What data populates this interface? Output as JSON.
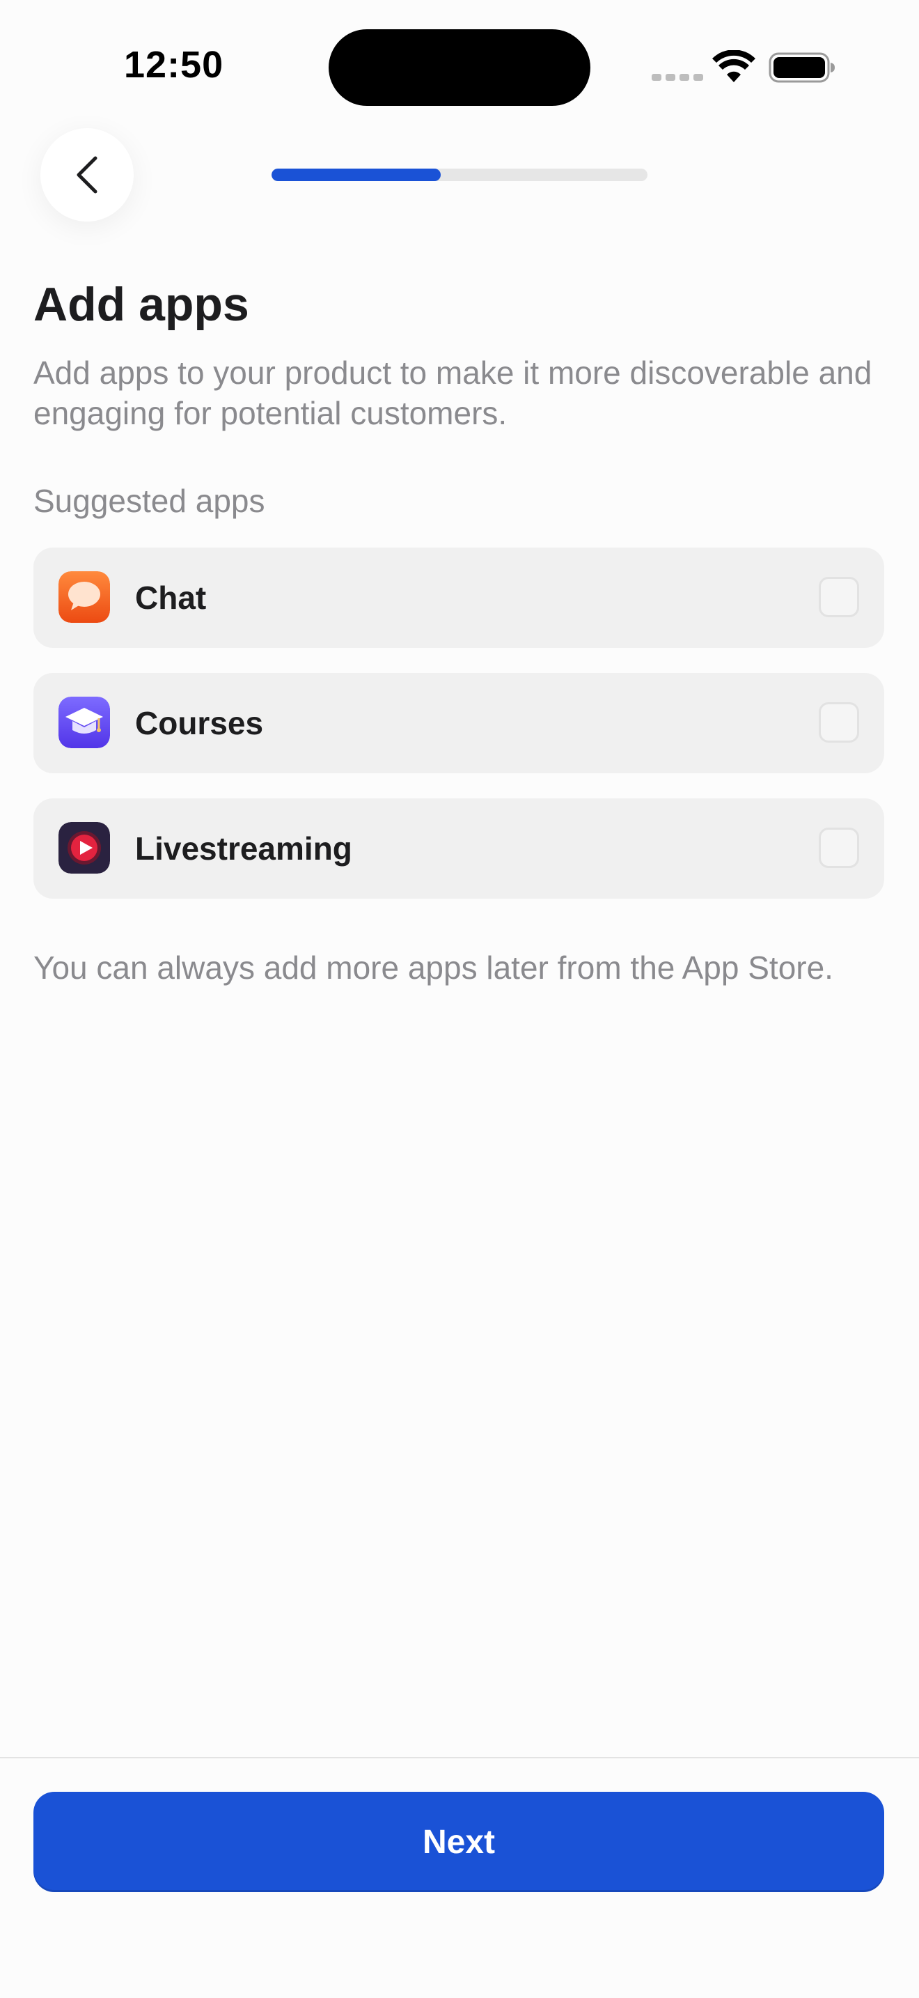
{
  "status_bar": {
    "time": "12:50"
  },
  "header": {
    "back_icon": "chevron-left-icon",
    "progress": 0.45
  },
  "content": {
    "title": "Add apps",
    "subtitle": "Add apps to your product to make it more discoverable and engaging for potential customers.",
    "section_label": "Suggested apps",
    "apps": [
      {
        "name": "Chat",
        "icon": "chat-bubble-icon",
        "checked": false
      },
      {
        "name": "Courses",
        "icon": "graduation-cap-icon",
        "checked": false
      },
      {
        "name": "Livestreaming",
        "icon": "play-record-icon",
        "checked": false
      }
    ],
    "footer_note": "You can always add more apps later from the App Store."
  },
  "footer": {
    "next_label": "Next"
  },
  "colors": {
    "accent": "#1a52d6",
    "background": "#fcfcfc",
    "row_background": "#f0f0f0",
    "secondary_text": "#8a8a8e"
  }
}
